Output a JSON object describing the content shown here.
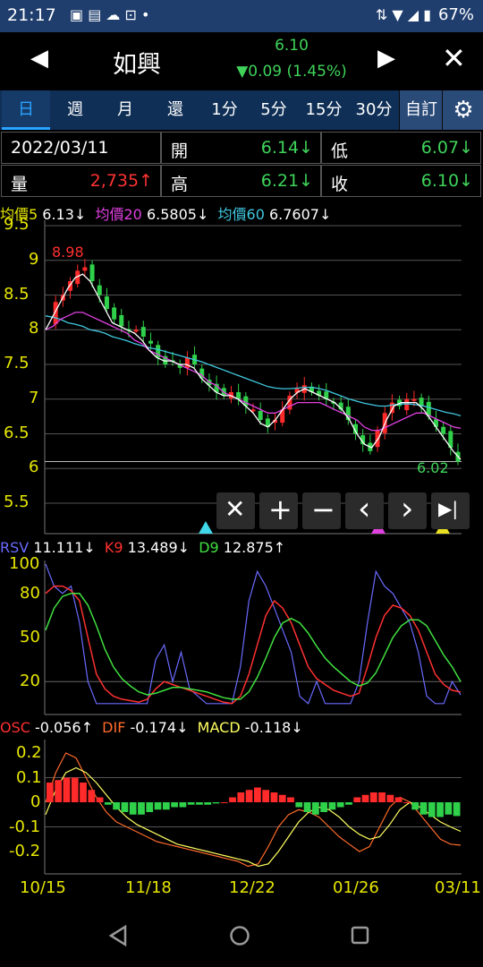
{
  "status_bar": {
    "time": "21:17",
    "battery": "67%"
  },
  "header": {
    "stock_name": "如興",
    "price": "6.10",
    "change": "▼0.09 (1.45%)"
  },
  "tabs": [
    "日",
    "週",
    "月",
    "還",
    "1分",
    "5分",
    "15分",
    "30分"
  ],
  "tab_custom": "自訂",
  "info": {
    "date": "2022/03/11",
    "open_label": "開",
    "open_value": "6.14↓",
    "low_label": "低",
    "low_value": "6.07↓",
    "volume_label": "量",
    "volume_value": "2,735↑",
    "high_label": "高",
    "high_value": "6.21↓",
    "close_label": "收",
    "close_value": "6.10↓"
  },
  "ma_legend": {
    "ma5_label": "均價5",
    "ma5_value": "6.13↓",
    "ma20_label": "均價20",
    "ma20_value": "6.5805↓",
    "ma60_label": "均價60",
    "ma60_value": "6.7607↓"
  },
  "price_axis": [
    "9.5",
    "9",
    "8.5",
    "8",
    "7.5",
    "7",
    "6.5",
    "6",
    "5.5"
  ],
  "price_annotations": {
    "high": "8.98",
    "low": "6.02"
  },
  "kd_legend": {
    "rsv_label": "RSV",
    "rsv_value": "11.111↓",
    "k_label": "K9",
    "k_value": "13.489↓",
    "d_label": "D9",
    "d_value": "12.875↑"
  },
  "kd_axis": [
    "100",
    "80",
    "50",
    "20"
  ],
  "macd_legend": {
    "osc_label": "OSC",
    "osc_value": "-0.056↑",
    "dif_label": "DIF",
    "dif_value": "-0.174↓",
    "macd_label": "MACD",
    "macd_value": "-0.118↓"
  },
  "macd_axis": [
    "0.2",
    "0.1",
    "0",
    "-0.1",
    "-0.2"
  ],
  "x_axis": [
    "10/15",
    "11/18",
    "12/22",
    "01/26",
    "03/11"
  ],
  "tools": [
    "✕",
    "+",
    "−",
    "‹",
    "›",
    "▶|"
  ],
  "colors": {
    "up": "#ff2a2a",
    "down": "#2fd14a",
    "ma5": "#ffffff",
    "ma20": "#e040e0",
    "ma60": "#40c8e0",
    "k": "#ff3030",
    "d": "#40e040",
    "rsv": "#6a6aff",
    "dif": "#ff6a2a",
    "macd": "#ffff60",
    "axis": "#e6e600"
  },
  "chart_data": {
    "type": "candlestick",
    "x_tick_labels": [
      "10/15",
      "11/18",
      "12/22",
      "01/26",
      "03/11"
    ],
    "price": {
      "ylim": [
        5.2,
        9.5
      ],
      "high_marker": 8.98,
      "low_marker": 6.02,
      "close_path": [
        8.1,
        8.4,
        8.5,
        8.7,
        8.85,
        8.9,
        8.7,
        8.5,
        8.3,
        8.15,
        8.05,
        8.0,
        8.0,
        7.9,
        7.8,
        7.6,
        7.5,
        7.55,
        7.45,
        7.6,
        7.5,
        7.3,
        7.2,
        7.1,
        7.05,
        7.1,
        7.0,
        6.9,
        6.85,
        6.7,
        6.6,
        6.7,
        6.85,
        7.05,
        7.15,
        7.2,
        7.1,
        7.05,
        7.0,
        6.95,
        6.85,
        6.7,
        6.5,
        6.35,
        6.25,
        6.55,
        6.8,
        6.95,
        6.9,
        7.0,
        7.0,
        6.9,
        6.75,
        6.6,
        6.5,
        6.3,
        6.1
      ],
      "ma5": [
        8.0,
        8.2,
        8.4,
        8.6,
        8.75,
        8.8,
        8.7,
        8.5,
        8.3,
        8.1,
        8.05,
        8.0,
        7.95,
        7.85,
        7.7,
        7.6,
        7.55,
        7.55,
        7.5,
        7.5,
        7.45,
        7.3,
        7.2,
        7.1,
        7.05,
        7.05,
        7.0,
        6.9,
        6.8,
        6.65,
        6.6,
        6.7,
        6.85,
        7.0,
        7.1,
        7.15,
        7.1,
        7.05,
        7.0,
        6.95,
        6.85,
        6.7,
        6.5,
        6.35,
        6.3,
        6.45,
        6.7,
        6.9,
        6.95,
        6.95,
        6.95,
        6.85,
        6.7,
        6.55,
        6.4,
        6.25,
        6.13
      ],
      "ma20": [
        8.0,
        8.05,
        8.15,
        8.2,
        8.25,
        8.25,
        8.2,
        8.15,
        8.1,
        8.05,
        8.0,
        7.95,
        7.85,
        7.8,
        7.7,
        7.65,
        7.6,
        7.55,
        7.5,
        7.45,
        7.4,
        7.35,
        7.25,
        7.2,
        7.1,
        7.05,
        7.0,
        6.95,
        6.9,
        6.85,
        6.8,
        6.8,
        6.85,
        6.9,
        6.95,
        6.95,
        6.95,
        6.95,
        6.9,
        6.85,
        6.8,
        6.75,
        6.7,
        6.6,
        6.55,
        6.55,
        6.6,
        6.65,
        6.7,
        6.75,
        6.8,
        6.8,
        6.75,
        6.7,
        6.65,
        6.6,
        6.58
      ],
      "ma60": [
        8.2,
        8.18,
        8.15,
        8.1,
        8.08,
        8.05,
        8.0,
        7.98,
        7.95,
        7.9,
        7.87,
        7.84,
        7.8,
        7.77,
        7.74,
        7.72,
        7.69,
        7.66,
        7.63,
        7.6,
        7.57,
        7.54,
        7.5,
        7.46,
        7.42,
        7.38,
        7.34,
        7.3,
        7.26,
        7.22,
        7.18,
        7.16,
        7.15,
        7.15,
        7.16,
        7.17,
        7.17,
        7.15,
        7.12,
        7.08,
        7.04,
        7.0,
        6.97,
        6.94,
        6.92,
        6.9,
        6.9,
        6.92,
        6.93,
        6.93,
        6.92,
        6.9,
        6.87,
        6.84,
        6.81,
        6.79,
        6.76
      ]
    },
    "kd": {
      "ylim": [
        0,
        100
      ],
      "k": [
        80,
        85,
        85,
        82,
        75,
        50,
        25,
        15,
        10,
        8,
        7,
        6,
        8,
        15,
        20,
        18,
        16,
        14,
        12,
        10,
        8,
        6,
        5,
        10,
        25,
        45,
        65,
        75,
        70,
        60,
        45,
        30,
        22,
        18,
        14,
        12,
        10,
        12,
        30,
        50,
        65,
        72,
        70,
        65,
        55,
        40,
        25,
        18,
        14,
        13
      ],
      "d": [
        55,
        70,
        78,
        80,
        80,
        72,
        58,
        42,
        30,
        22,
        17,
        13,
        11,
        12,
        14,
        16,
        16,
        15,
        14,
        13,
        11,
        9,
        8,
        8,
        13,
        23,
        36,
        50,
        60,
        63,
        60,
        53,
        44,
        36,
        30,
        25,
        20,
        17,
        19,
        26,
        38,
        50,
        58,
        62,
        62,
        58,
        48,
        38,
        30,
        20
      ],
      "rsv": [
        100,
        85,
        80,
        85,
        60,
        20,
        5,
        5,
        5,
        5,
        5,
        5,
        5,
        35,
        45,
        20,
        40,
        15,
        10,
        5,
        5,
        5,
        5,
        30,
        75,
        95,
        85,
        70,
        55,
        40,
        10,
        5,
        20,
        5,
        5,
        5,
        5,
        20,
        60,
        95,
        85,
        80,
        70,
        60,
        40,
        10,
        5,
        5,
        20,
        11
      ]
    },
    "macd": {
      "ylim": [
        -0.25,
        0.25
      ],
      "osc": [
        0.08,
        0.09,
        0.1,
        0.1,
        0.08,
        0.05,
        0.02,
        -0.01,
        -0.03,
        -0.04,
        -0.05,
        -0.05,
        -0.04,
        -0.03,
        -0.03,
        -0.02,
        -0.02,
        -0.01,
        -0.01,
        -0.01,
        -0.005,
        0.0,
        0.02,
        0.04,
        0.05,
        0.06,
        0.05,
        0.04,
        0.03,
        0.02,
        -0.02,
        -0.04,
        -0.05,
        -0.04,
        -0.03,
        -0.02,
        -0.01,
        0.02,
        0.03,
        0.04,
        0.04,
        0.03,
        0.02,
        0.0,
        -0.03,
        -0.05,
        -0.06,
        -0.06,
        -0.05,
        -0.056
      ],
      "dif": [
        0.0,
        0.12,
        0.2,
        0.18,
        0.1,
        0.02,
        -0.04,
        -0.08,
        -0.1,
        -0.12,
        -0.14,
        -0.16,
        -0.17,
        -0.18,
        -0.19,
        -0.2,
        -0.21,
        -0.22,
        -0.23,
        -0.24,
        -0.26,
        -0.25,
        -0.18,
        -0.1,
        -0.05,
        -0.03,
        -0.04,
        -0.06,
        -0.1,
        -0.14,
        -0.17,
        -0.2,
        -0.18,
        -0.1,
        -0.02,
        0.02,
        0.0,
        -0.05,
        -0.1,
        -0.15,
        -0.17,
        -0.174
      ],
      "macd": [
        -0.05,
        0.05,
        0.12,
        0.14,
        0.12,
        0.08,
        0.03,
        -0.02,
        -0.06,
        -0.09,
        -0.11,
        -0.13,
        -0.15,
        -0.17,
        -0.18,
        -0.19,
        -0.2,
        -0.21,
        -0.22,
        -0.23,
        -0.24,
        -0.26,
        -0.25,
        -0.2,
        -0.14,
        -0.08,
        -0.04,
        -0.02,
        -0.03,
        -0.06,
        -0.1,
        -0.13,
        -0.15,
        -0.14,
        -0.09,
        -0.03,
        0.0,
        -0.02,
        -0.05,
        -0.08,
        -0.1,
        -0.118
      ]
    }
  }
}
